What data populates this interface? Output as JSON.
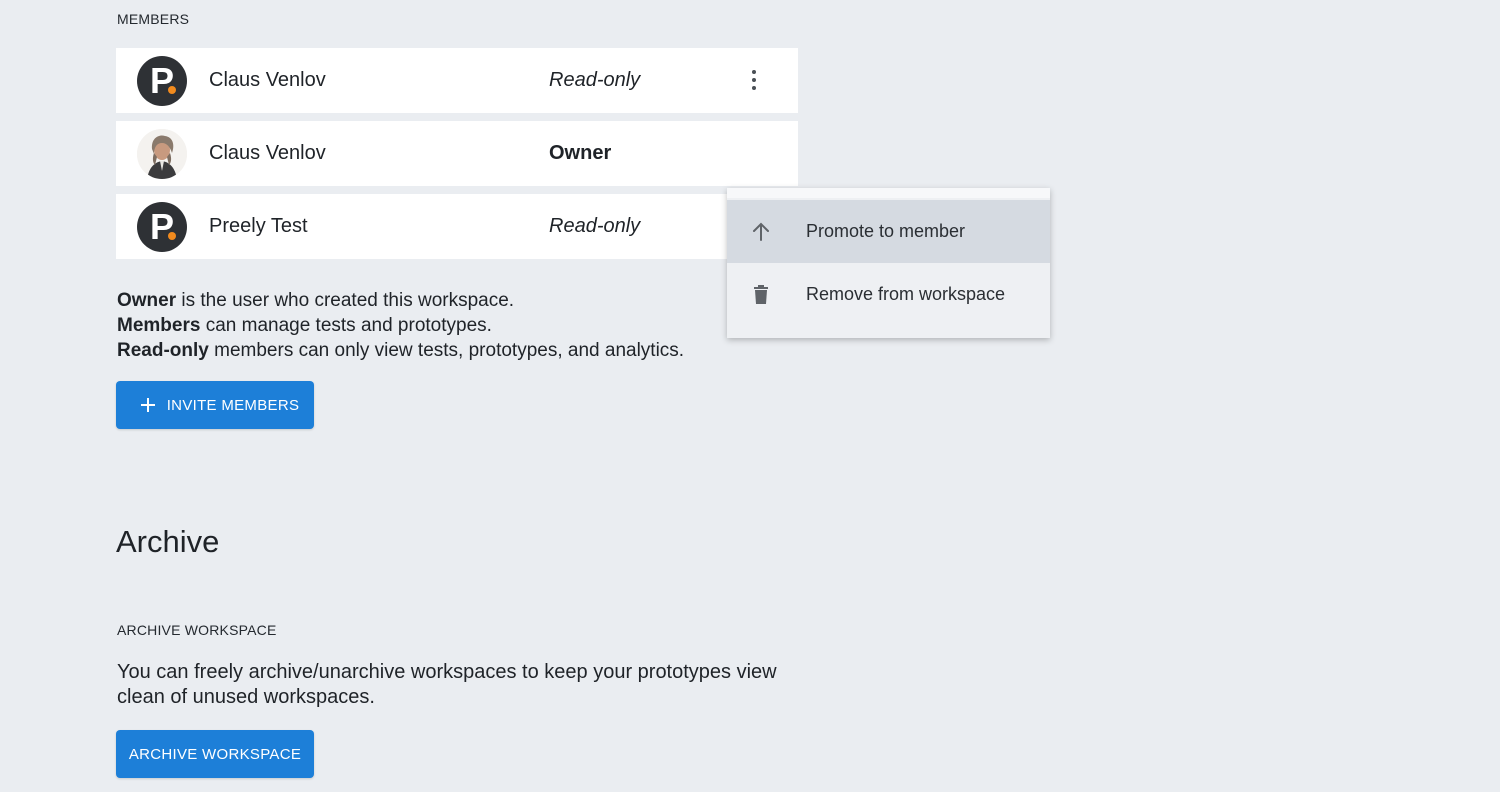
{
  "members_section": {
    "label": "MEMBERS",
    "rows": [
      {
        "name": "Claus Venlov",
        "role": "Read-only",
        "avatar": "preely-logo",
        "has_menu": true
      },
      {
        "name": "Claus Venlov",
        "role": "Owner",
        "avatar": "user-photo",
        "has_menu": false
      },
      {
        "name": "Preely Test",
        "role": "Read-only",
        "avatar": "preely-logo",
        "has_menu": false
      }
    ]
  },
  "context_menu": {
    "items": [
      {
        "label": "Promote to member",
        "icon": "arrow-up-icon"
      },
      {
        "label": "Remove from workspace",
        "icon": "trash-icon"
      }
    ]
  },
  "legend": {
    "owner_term": "Owner",
    "owner_text": " is the user who created this workspace.",
    "members_term": "Members",
    "members_text": " can manage tests and prototypes.",
    "readonly_term": "Read-only",
    "readonly_text": " members can only view tests, prototypes, and analytics."
  },
  "invite_button": {
    "label": "INVITE MEMBERS",
    "icon": "plus-icon"
  },
  "archive_section": {
    "title": "Archive",
    "label": "ARCHIVE WORKSPACE",
    "description": "You can freely archive/unarchive workspaces to keep your prototypes view clean of unused workspaces.",
    "button_label": "ARCHIVE WORKSPACE"
  },
  "colors": {
    "background": "#eaedf1",
    "primary": "#1d7fd8",
    "logo_dark": "#2e3135",
    "logo_accent": "#f28b1e"
  }
}
